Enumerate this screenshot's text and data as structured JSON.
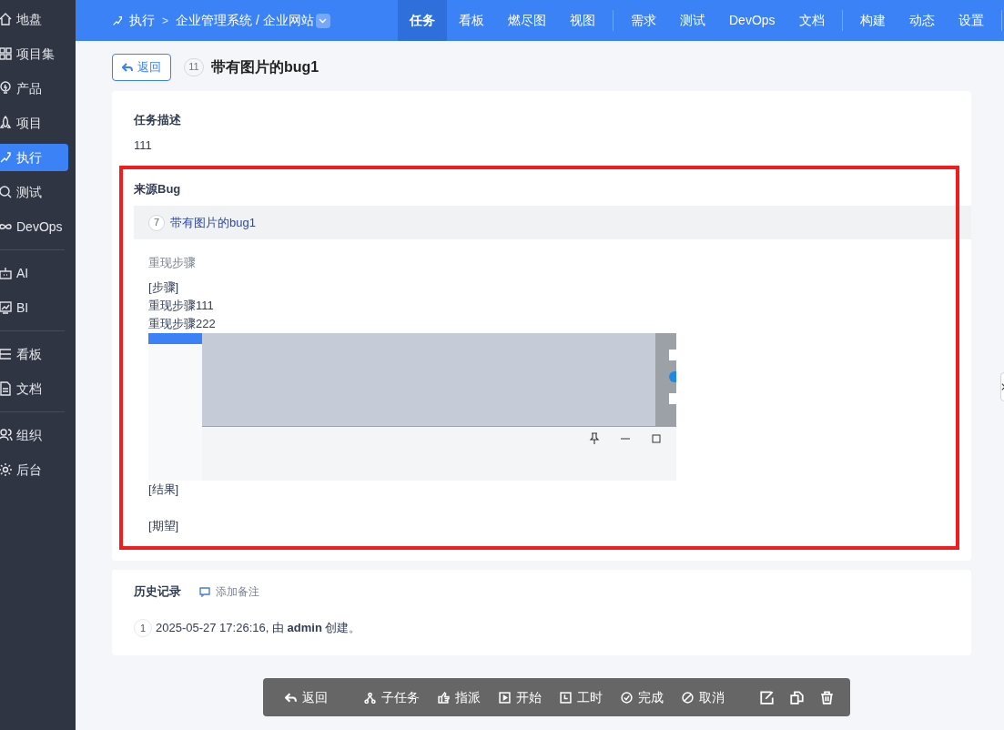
{
  "sidebar": {
    "groups": [
      [
        {
          "label": "地盘",
          "selected": false
        },
        {
          "label": "项目集",
          "selected": false
        },
        {
          "label": "产品",
          "selected": false
        },
        {
          "label": "项目",
          "selected": false
        },
        {
          "label": "执行",
          "selected": true
        },
        {
          "label": "测试",
          "selected": false
        },
        {
          "label": "DevOps",
          "selected": false
        }
      ],
      [
        {
          "label": "AI",
          "selected": false
        },
        {
          "label": "BI",
          "selected": false
        }
      ],
      [
        {
          "label": "看板",
          "selected": false
        },
        {
          "label": "文档",
          "selected": false
        }
      ],
      [
        {
          "label": "组织",
          "selected": false
        },
        {
          "label": "后台",
          "selected": false
        }
      ]
    ]
  },
  "topbar": {
    "module": "执行",
    "breadcrumb_separator": ">",
    "project": "企业管理系统 / 企业网站",
    "tab_groups": [
      [
        {
          "label": "任务",
          "selected": true
        },
        {
          "label": "看板",
          "selected": false
        },
        {
          "label": "燃尽图",
          "selected": false
        },
        {
          "label": "视图",
          "selected": false
        }
      ],
      [
        {
          "label": "需求",
          "selected": false
        },
        {
          "label": "测试",
          "selected": false
        },
        {
          "label": "DevOps",
          "selected": false
        },
        {
          "label": "文档",
          "selected": false
        }
      ],
      [
        {
          "label": "构建",
          "selected": false
        },
        {
          "label": "动态",
          "selected": false
        },
        {
          "label": "设置",
          "selected": false
        }
      ]
    ]
  },
  "header": {
    "back_button": "返回",
    "id": "11",
    "title": "带有图片的bug1"
  },
  "description": {
    "heading": "任务描述",
    "text": "111"
  },
  "source_bug": {
    "heading": "来源Bug",
    "id": "7",
    "title": "带有图片的bug1",
    "steps_heading": "重现步骤",
    "lines_before_image": [
      "[步骤]",
      "重现步骤111",
      "重现步骤222"
    ],
    "lines_after_image": [
      "[结果]",
      "[期望]"
    ]
  },
  "history": {
    "heading": "历史记录",
    "add_note": "添加备注",
    "entries": [
      {
        "index": "1",
        "text": "2025-05-27 17:26:16, 由 **admin** 创建。"
      }
    ]
  },
  "toolbar": {
    "groups": [
      [
        "返回"
      ],
      [
        "子任务",
        "指派",
        "开始",
        "工时",
        "完成",
        "取消"
      ]
    ]
  }
}
